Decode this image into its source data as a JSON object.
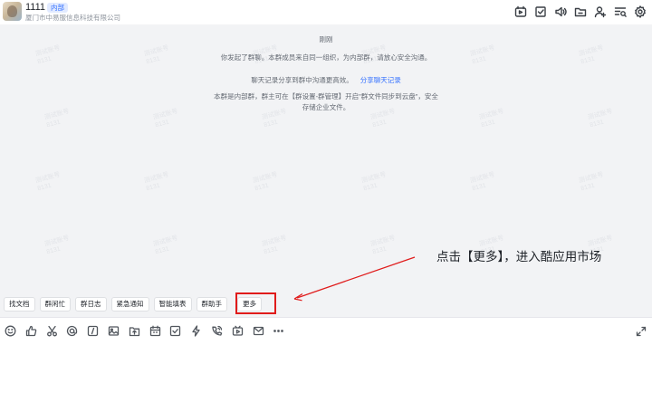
{
  "header": {
    "title": "1111",
    "tag": "内部",
    "org": "厦门市中易服信息科技有限公司",
    "icons": [
      "video-meeting-icon",
      "task-check-icon",
      "announcement-icon",
      "folder-icon",
      "add-member-icon",
      "search-list-icon",
      "settings-gear-icon"
    ]
  },
  "watermark": {
    "line1": "测试账号",
    "line2": "8131"
  },
  "messages": {
    "time": "刚刚",
    "started": "你发起了群聊。本群成员来自同一组织，为内部群，请放心安全沟通。",
    "share_text": "聊天记录分享到群中沟通更高效。",
    "share_link": "分享聊天记录",
    "storage_line1": "本群是内部群，群主可在【群设置-群管理】开启\"群文件同步到云盘\"，安全",
    "storage_line2": "存储企业文件。"
  },
  "chips": [
    {
      "name": "chip-find-doc",
      "label": "找文档"
    },
    {
      "name": "chip-group-busy",
      "label": "群闲忙"
    },
    {
      "name": "chip-group-log",
      "label": "群日志"
    },
    {
      "name": "chip-urgent-notice",
      "label": "紧急通知"
    },
    {
      "name": "chip-smart-form",
      "label": "智能填表"
    },
    {
      "name": "chip-group-assistant",
      "label": "群助手"
    },
    {
      "name": "chip-more",
      "label": "更多"
    }
  ],
  "annotation": {
    "text": "点击【更多】，进入酷应用市场",
    "arrow_color": "#e01b1b",
    "highlight_color": "#e01b1b"
  },
  "toolbar": {
    "icons": [
      "emoji-icon",
      "thumbs-up-icon",
      "screenshot-scissors-icon",
      "mention-at-icon",
      "text-format-icon",
      "image-icon",
      "upload-file-icon",
      "calendar-icon",
      "checkbox-task-icon",
      "flash-ding-icon",
      "phone-call-icon",
      "live-video-icon",
      "mail-icon",
      "more-dots-icon"
    ],
    "expand_icon": "expand-icon"
  },
  "colors": {
    "accent": "#3370ff",
    "chat_bg": "#f2f3f5"
  }
}
